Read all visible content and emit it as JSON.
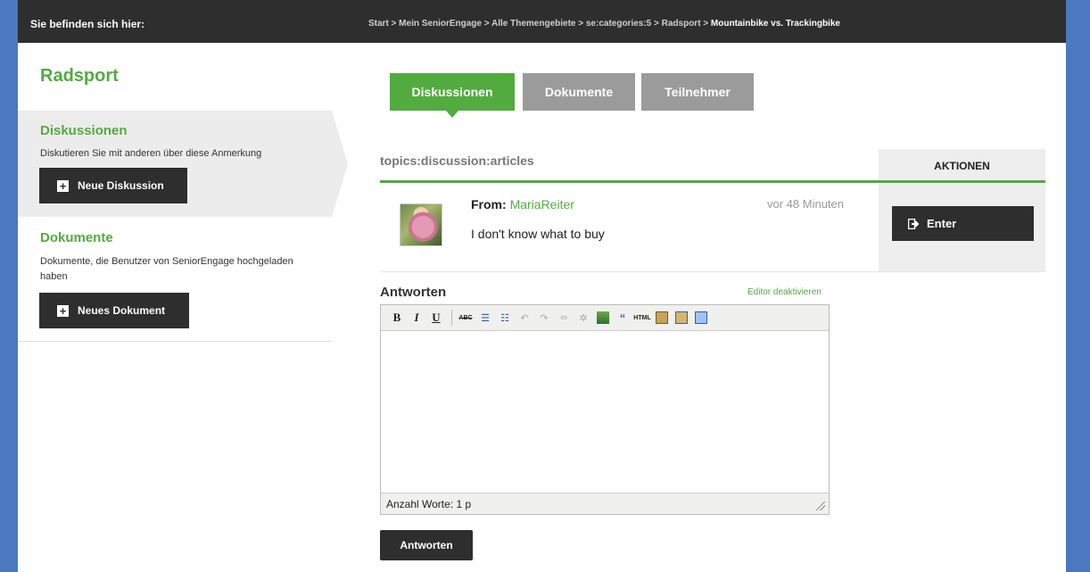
{
  "breadcrumb": {
    "label": "Sie befinden sich hier:",
    "path": "Start > Mein SeniorEngage > Alle Themengebiete > se:categories:5 > Radsport > ",
    "current": "Mountainbike vs. Trackingbike"
  },
  "sidebar": {
    "title": "Radsport",
    "discussions": {
      "heading": "Diskussionen",
      "text": "Diskutieren Sie mit anderen über diese Anmerkung",
      "button": "Neue Diskussion"
    },
    "documents": {
      "heading": "Dokumente",
      "text": "Dokumente, die Benutzer von SeniorEngage hochgeladen haben",
      "button": "Neues Dokument"
    }
  },
  "tabs": [
    {
      "label": "Diskussionen",
      "active": true
    },
    {
      "label": "Dokumente",
      "active": false
    },
    {
      "label": "Teilnehmer",
      "active": false
    }
  ],
  "discussion": {
    "heading": "topics:discussion:articles",
    "actions_header": "AKTIONEN",
    "post": {
      "from_label": "From:",
      "author": "MariaReiter",
      "time": "vor 48 Minuten",
      "message": "I don't know what to buy",
      "action_button": "Enter"
    }
  },
  "reply": {
    "heading": "Antworten",
    "editor_toggle": "Editor deaktivieren",
    "word_count": "Anzahl Worte: 1 p",
    "submit_label": "Antworten"
  },
  "colors": {
    "accent": "#52ab3e",
    "dark": "#2e2e2e",
    "tab_inactive": "#9b9b9b"
  }
}
